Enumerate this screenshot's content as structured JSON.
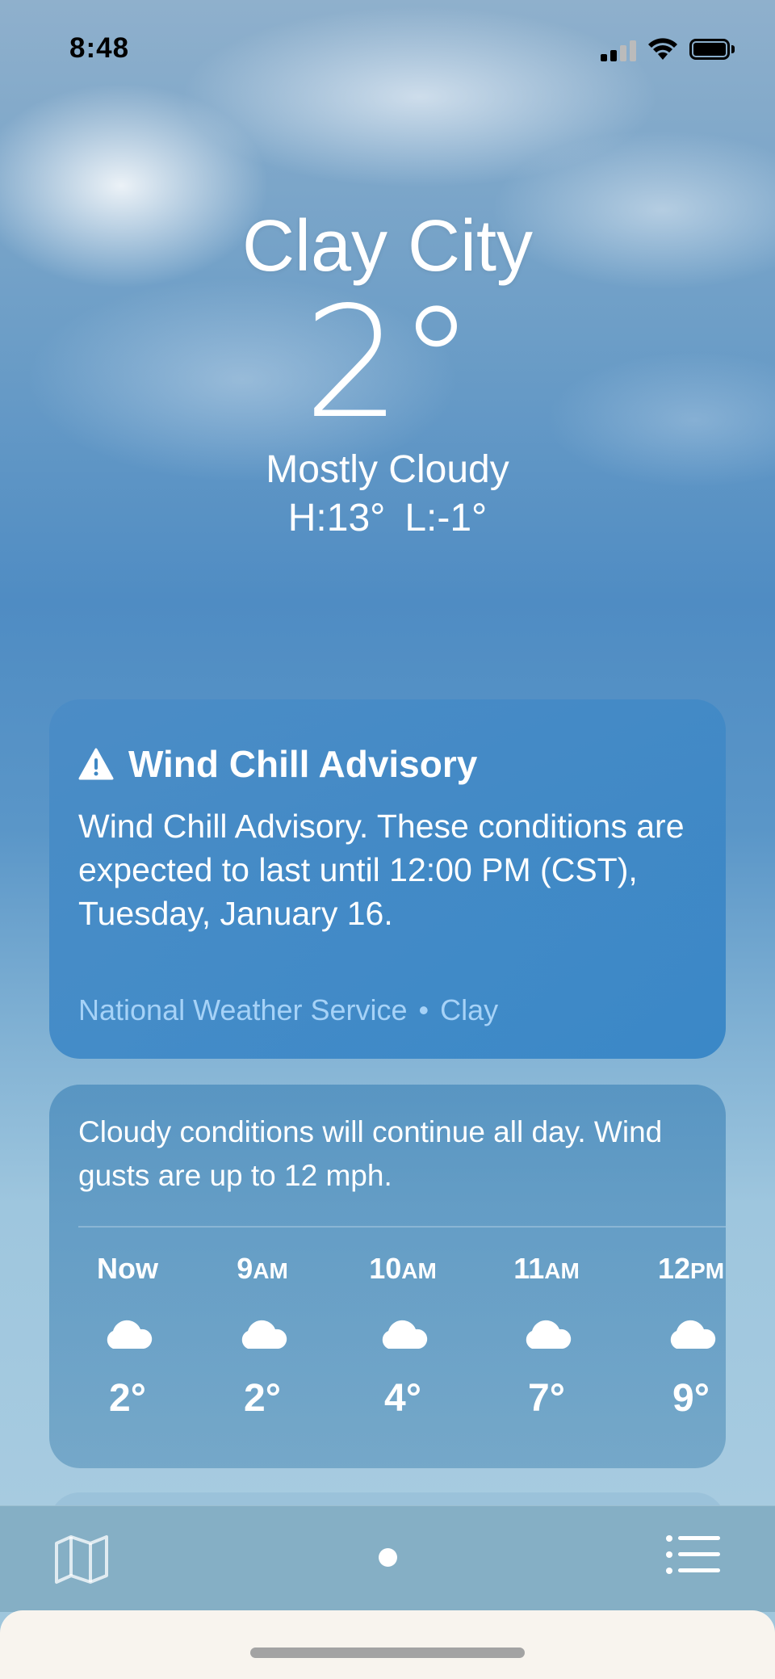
{
  "status_bar": {
    "time": "8:48"
  },
  "location": {
    "city": "Clay City",
    "temperature": "2°",
    "condition": "Mostly Cloudy",
    "high": "H:13°",
    "low": "L:-1°"
  },
  "alert": {
    "title": "Wind Chill Advisory",
    "body": "Wind Chill Advisory. These conditions are expected to last until 12:00 PM (CST), Tuesday, January 16.",
    "source": "National Weather Service",
    "separator": "•",
    "region": "Clay"
  },
  "hourly": {
    "summary": "Cloudy conditions will continue all day. Wind gusts are up to 12 mph.",
    "hours": [
      {
        "hour": "Now",
        "suffix": "",
        "icon": "cloud-icon",
        "temp": "2°"
      },
      {
        "hour": "9",
        "suffix": "AM",
        "icon": "cloud-icon",
        "temp": "2°"
      },
      {
        "hour": "10",
        "suffix": "AM",
        "icon": "cloud-icon",
        "temp": "4°"
      },
      {
        "hour": "11",
        "suffix": "AM",
        "icon": "cloud-icon",
        "temp": "7°"
      },
      {
        "hour": "12",
        "suffix": "PM",
        "icon": "cloud-icon",
        "temp": "9°"
      }
    ]
  },
  "toolbar": {
    "left_icon": "map-icon",
    "center_icon": "page-indicator-dot",
    "right_icon": "list-icon"
  }
}
